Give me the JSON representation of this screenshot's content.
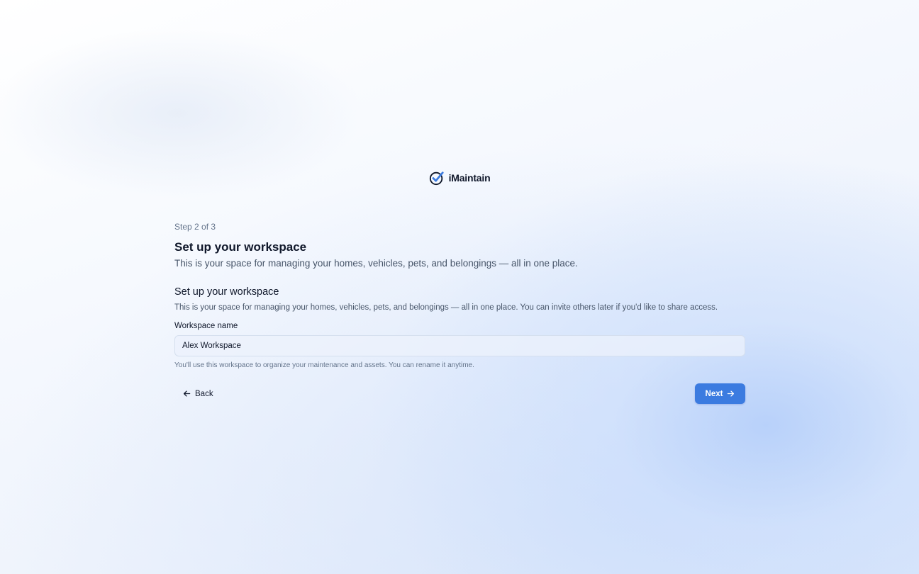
{
  "brand": {
    "name": "iMaintain",
    "icon": "check-circle-icon"
  },
  "onboarding": {
    "step_label": "Step 2 of 3",
    "title": "Set up your workspace",
    "subtitle": "This is your space for managing your homes, vehicles, pets, and belongings — all in one place.",
    "section_title": "Set up your workspace",
    "section_description": "This is your space for managing your homes, vehicles, pets, and belongings — all in one place. You can invite others later if you'd like to share access.",
    "field": {
      "label": "Workspace name",
      "value": "Alex Workspace",
      "helper": "You'll use this workspace to organize your maintenance and assets. You can rename it anytime."
    },
    "back_label": "Back",
    "next_label": "Next"
  },
  "colors": {
    "accent": "#3b7be0",
    "text": "#0f172a",
    "muted": "#64748b"
  }
}
